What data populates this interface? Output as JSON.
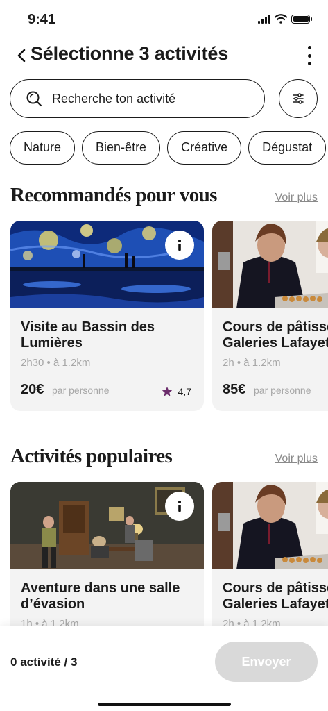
{
  "status_bar": {
    "time": "9:41"
  },
  "header": {
    "title": "Sélectionne 3 activités"
  },
  "search": {
    "placeholder": "Recherche ton activité"
  },
  "chips": [
    "Nature",
    "Bien-être",
    "Créative",
    "Dégustat"
  ],
  "sections": [
    {
      "title": "Recommandés pour vous",
      "see_more": "Voir plus",
      "cards": [
        {
          "title": "Visite au Bassin des Lumières",
          "meta": "2h30 • à 1.2km",
          "price": "20€",
          "unit": "par personne",
          "rating": "4,7"
        },
        {
          "title": "Cours de pâtisserie Galeries Lafayette",
          "meta": "2h • à 1.2km",
          "price": "85€",
          "unit": "par personne"
        }
      ]
    },
    {
      "title": "Activités populaires",
      "see_more": "Voir plus",
      "cards": [
        {
          "title": "Aventure dans une salle d’évasion",
          "meta": "1h • à 1.2km"
        },
        {
          "title": "Cours de pâtisserie Galeries Lafayette",
          "meta": "2h • à 1.2km"
        }
      ]
    }
  ],
  "footer": {
    "count": "0",
    "count_label": "activité",
    "count_total": "/ 3",
    "send_label": "Envoyer"
  },
  "colors": {
    "accent_star": "#6b2c6b",
    "disabled_button": "#d9d9d9",
    "muted_text": "#a7a7a7"
  }
}
